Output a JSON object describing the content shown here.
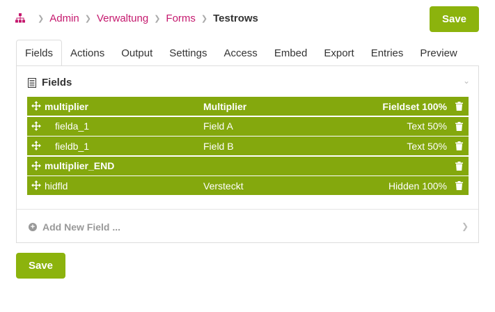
{
  "breadcrumb": {
    "items": [
      "Admin",
      "Verwaltung",
      "Forms"
    ],
    "current": "Testrows"
  },
  "save_label": "Save",
  "tabs": [
    "Fields",
    "Actions",
    "Output",
    "Settings",
    "Access",
    "Embed",
    "Export",
    "Entries",
    "Preview"
  ],
  "active_tab": "Fields",
  "panel": {
    "title": "Fields",
    "rows": [
      {
        "name": "multiplier",
        "label": "Multiplier",
        "type": "Fieldset 100%"
      },
      {
        "name": "fielda_1",
        "label": "Field A",
        "type": "Text 50%"
      },
      {
        "name": "fieldb_1",
        "label": "Field B",
        "type": "Text 50%"
      },
      {
        "name": "multiplier_END",
        "label": "",
        "type": ""
      },
      {
        "name": "hidfld",
        "label": "Versteckt",
        "type": "Hidden 100%"
      }
    ],
    "add_field": "Add New Field ..."
  },
  "colors": {
    "accent": "#8cb30d",
    "row": "#84a80d",
    "link": "#c5196e"
  }
}
